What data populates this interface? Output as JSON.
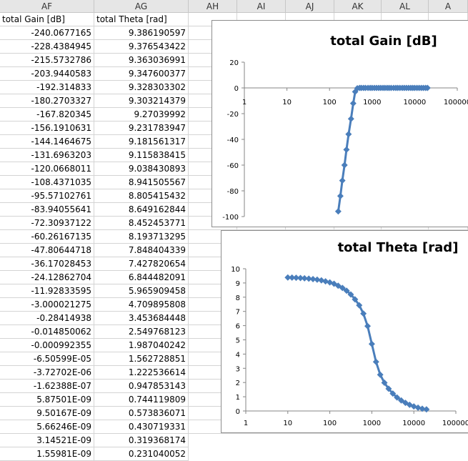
{
  "columns": [
    "AF",
    "AG",
    "AH",
    "AI",
    "AJ",
    "AK",
    "AL",
    "A"
  ],
  "table": {
    "headers": [
      "total Gain [dB]",
      "total Theta [rad]"
    ],
    "rows": [
      [
        "-240.0677165",
        "9.386190597"
      ],
      [
        "-228.4384945",
        "9.376543422"
      ],
      [
        "-215.5732786",
        "9.363036991"
      ],
      [
        "-203.9440583",
        "9.347600377"
      ],
      [
        "-192.314833",
        "9.328303302"
      ],
      [
        "-180.2703327",
        "9.303214379"
      ],
      [
        "-167.820345",
        "9.27039992"
      ],
      [
        "-156.1910631",
        "9.231783947"
      ],
      [
        "-144.1464675",
        "9.181561317"
      ],
      [
        "-131.6963203",
        "9.115838415"
      ],
      [
        "-120.0668011",
        "9.038430893"
      ],
      [
        "-108.4371035",
        "8.941505567"
      ],
      [
        "-95.57102761",
        "8.805415432"
      ],
      [
        "-83.94055641",
        "8.649162844"
      ],
      [
        "-72.30937122",
        "8.452453771"
      ],
      [
        "-60.26167135",
        "8.193713295"
      ],
      [
        "-47.80644718",
        "7.848404339"
      ],
      [
        "-36.17028453",
        "7.427820654"
      ],
      [
        "-24.12862704",
        "6.844482091"
      ],
      [
        "-11.92833595",
        "5.965909458"
      ],
      [
        "-3.000021275",
        "4.709895808"
      ],
      [
        "-0.28414938",
        "3.453684448"
      ],
      [
        "-0.014850062",
        "2.549768123"
      ],
      [
        "-0.000992355",
        "1.987040242"
      ],
      [
        "-6.50599E-05",
        "1.562728851"
      ],
      [
        "-3.72702E-06",
        "1.222536614"
      ],
      [
        "-1.62388E-07",
        "0.947853143"
      ],
      [
        "5.87501E-09",
        "0.744119809"
      ],
      [
        "9.50167E-09",
        "0.573836071"
      ],
      [
        "5.66246E-09",
        "0.430719331"
      ],
      [
        "3.14521E-09",
        "0.319368174"
      ],
      [
        "1.55981E-09",
        "0.231040052"
      ]
    ]
  },
  "chart_data": [
    {
      "type": "scatter",
      "title": "total Gain [dB]",
      "xscale": "log",
      "xlim": [
        1,
        100000
      ],
      "ylim": [
        -100,
        20
      ],
      "xticks": [
        "1",
        "10",
        "100",
        "1000",
        "10000",
        "100000"
      ],
      "yticks": [
        "20",
        "0",
        "-20",
        "-40",
        "-60",
        "-80",
        "-100"
      ],
      "series_color": "#4a7ebb",
      "x": [
        160,
        180,
        200,
        225,
        250,
        280,
        320,
        360,
        400,
        450,
        510,
        560,
        630,
        700,
        800,
        900,
        1000,
        1130,
        1270,
        1430,
        1600,
        1800,
        2000,
        2250,
        2500,
        2800,
        3200,
        3600,
        4000,
        4500,
        5100,
        5700,
        6400,
        7200,
        8100,
        9000,
        10000,
        11300,
        12700,
        14300,
        16000,
        18000,
        20000
      ],
      "y": [
        -96,
        -84,
        -72,
        -60,
        -48,
        -36,
        -24,
        -12,
        -3,
        -0.28,
        -0.015,
        -0.001,
        0,
        0,
        0,
        0,
        0,
        0,
        0,
        0,
        0,
        0,
        0,
        0,
        0,
        0,
        0,
        0,
        0,
        0,
        0,
        0,
        0,
        0,
        0,
        0,
        0,
        0,
        0,
        0,
        0,
        0,
        0
      ]
    },
    {
      "type": "scatter",
      "title": "total Theta [rad]",
      "xscale": "log",
      "xlim": [
        1,
        100000
      ],
      "ylim": [
        0,
        10
      ],
      "xticks": [
        "1",
        "10",
        "100",
        "1000",
        "10000",
        "100000"
      ],
      "yticks": [
        "10",
        "9",
        "8",
        "7",
        "6",
        "5",
        "4",
        "3",
        "2",
        "1",
        "0"
      ],
      "series_color": "#4a7ebb",
      "x": [
        10,
        12.6,
        15.8,
        20,
        25,
        31.6,
        39.8,
        50,
        63,
        79,
        100,
        126,
        158,
        200,
        251,
        316,
        398,
        501,
        631,
        794,
        1000,
        1259,
        1585,
        1995,
        2512,
        3162,
        3981,
        5012,
        6310,
        7943,
        10000,
        12589,
        15849,
        19953
      ],
      "y": [
        9.386,
        9.377,
        9.363,
        9.348,
        9.328,
        9.303,
        9.27,
        9.232,
        9.182,
        9.116,
        9.038,
        8.942,
        8.805,
        8.649,
        8.452,
        8.194,
        7.848,
        7.428,
        6.844,
        5.966,
        4.71,
        3.454,
        2.55,
        1.987,
        1.563,
        1.223,
        0.948,
        0.744,
        0.574,
        0.431,
        0.319,
        0.231,
        0.16,
        0.11
      ]
    }
  ]
}
